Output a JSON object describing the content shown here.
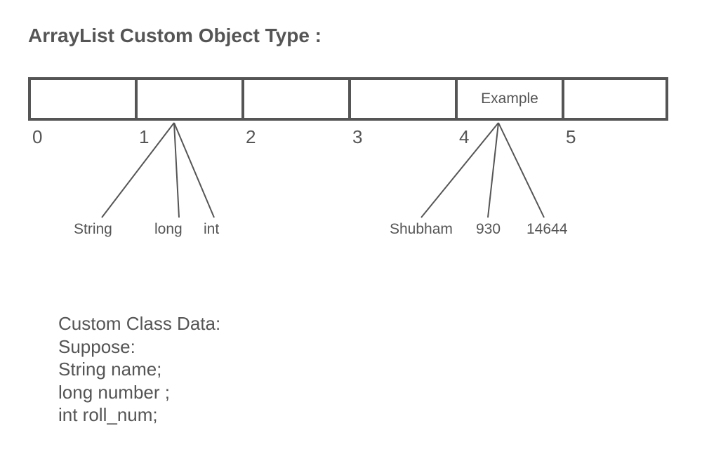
{
  "title": "ArrayList Custom Object Type :",
  "array": {
    "cells": [
      "",
      "",
      "",
      "",
      "Example",
      ""
    ],
    "indices": [
      "0",
      "1",
      "2",
      "3",
      "4",
      "5"
    ]
  },
  "type_labels": {
    "field1": "String",
    "field2": "long",
    "field3": "int"
  },
  "example_labels": {
    "value1": "Shubham",
    "value2": "930",
    "value3": "14644"
  },
  "class_data": {
    "line1": "Custom Class Data:",
    "line2": "Suppose:",
    "line3": "String name;",
    "line4": "long number ;",
    "line5": "int roll_num;"
  }
}
